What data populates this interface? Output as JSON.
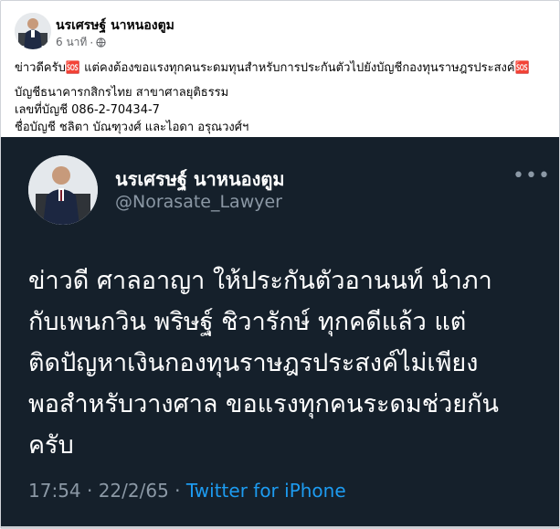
{
  "post": {
    "author_name": "นรเศรษฐ์ นาหนองตูม",
    "time": "6 นาที",
    "time_separator": "·",
    "privacy_icon": "globe-icon",
    "lines": [
      "ข่าวดีครับ🆘 แต่คงต้องขอแรงทุกคนระดมทุนสำหรับการประกันตัวไปยังบัญชีกองทุนราษฎรประสงค์🆘",
      "บัญชีธนาคารกสิกรไทย สาขาศาลยุติธรรม",
      "เลขที่บัญชี 086-2-70434-7",
      "ชื่อบัญชี ชลิตา บัณฑุวงศ์ และไอดา อรุณวงศ์ฯ"
    ]
  },
  "tweet": {
    "display_name": "นรเศรษฐ์ นาหนองตูม",
    "handle": "@Norasate_Lawyer",
    "more_label": "•••",
    "body_lines": [
      "ข่าวดี ศาลอาญา  ให้ประกันตัวอานนท์ นำภา",
      "กับเพนกวิน พริษฐ์ ชิวารักษ์ ทุกคดีแล้ว แต่",
      "ติดปัญหาเงินกองทุนราษฎรประสงค์ไม่เพียง",
      "พอสำหรับวางศาล ขอแรงทุกคนระดมช่วยกัน",
      "ครับ"
    ],
    "timestamp": "17:54 · 22/2/65 · ",
    "source": "Twitter for iPhone",
    "colors": {
      "background": "#15202b",
      "link": "#1d9bf0",
      "muted": "#8b98a5"
    }
  }
}
